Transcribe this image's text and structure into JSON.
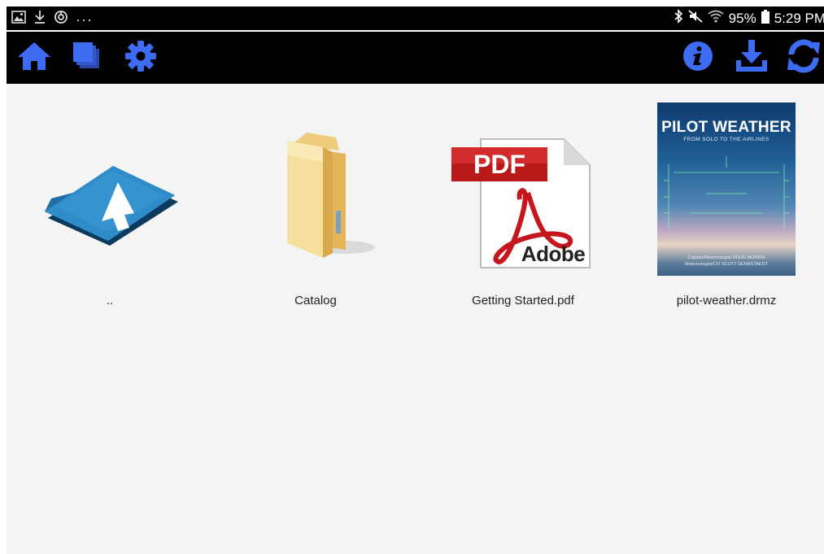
{
  "status_bar": {
    "left_icons": [
      "image-notification-icon",
      "download-notification-icon",
      "sync-notification-icon",
      "more-notifications-icon"
    ],
    "more_glyph": "···",
    "right_icons": [
      "bluetooth-icon",
      "mute-icon",
      "wifi-icon",
      "battery-icon"
    ],
    "battery_percent": "95%",
    "time": "5:29 PM"
  },
  "toolbar": {
    "left_buttons": [
      "home-button",
      "library-button",
      "settings-button"
    ],
    "right_buttons": [
      "info-button",
      "download-button",
      "refresh-button"
    ],
    "accent_color": "#3d6cf2"
  },
  "files": [
    {
      "name": "..",
      "type": "parent-folder"
    },
    {
      "name": "Catalog",
      "type": "folder"
    },
    {
      "name": "Getting Started.pdf",
      "type": "pdf",
      "badge": "PDF",
      "brand": "Adobe"
    },
    {
      "name": "pilot-weather.drmz",
      "type": "book",
      "cover": {
        "title": "PILOT WEATHER",
        "subtitle": "FROM SOLO TO THE AIRLINES",
        "author1": "Captain/Meteorologist DOUG MORRIS",
        "author2": "Meteorologist/CFI SCOTT DENNSTAEDT"
      }
    }
  ]
}
